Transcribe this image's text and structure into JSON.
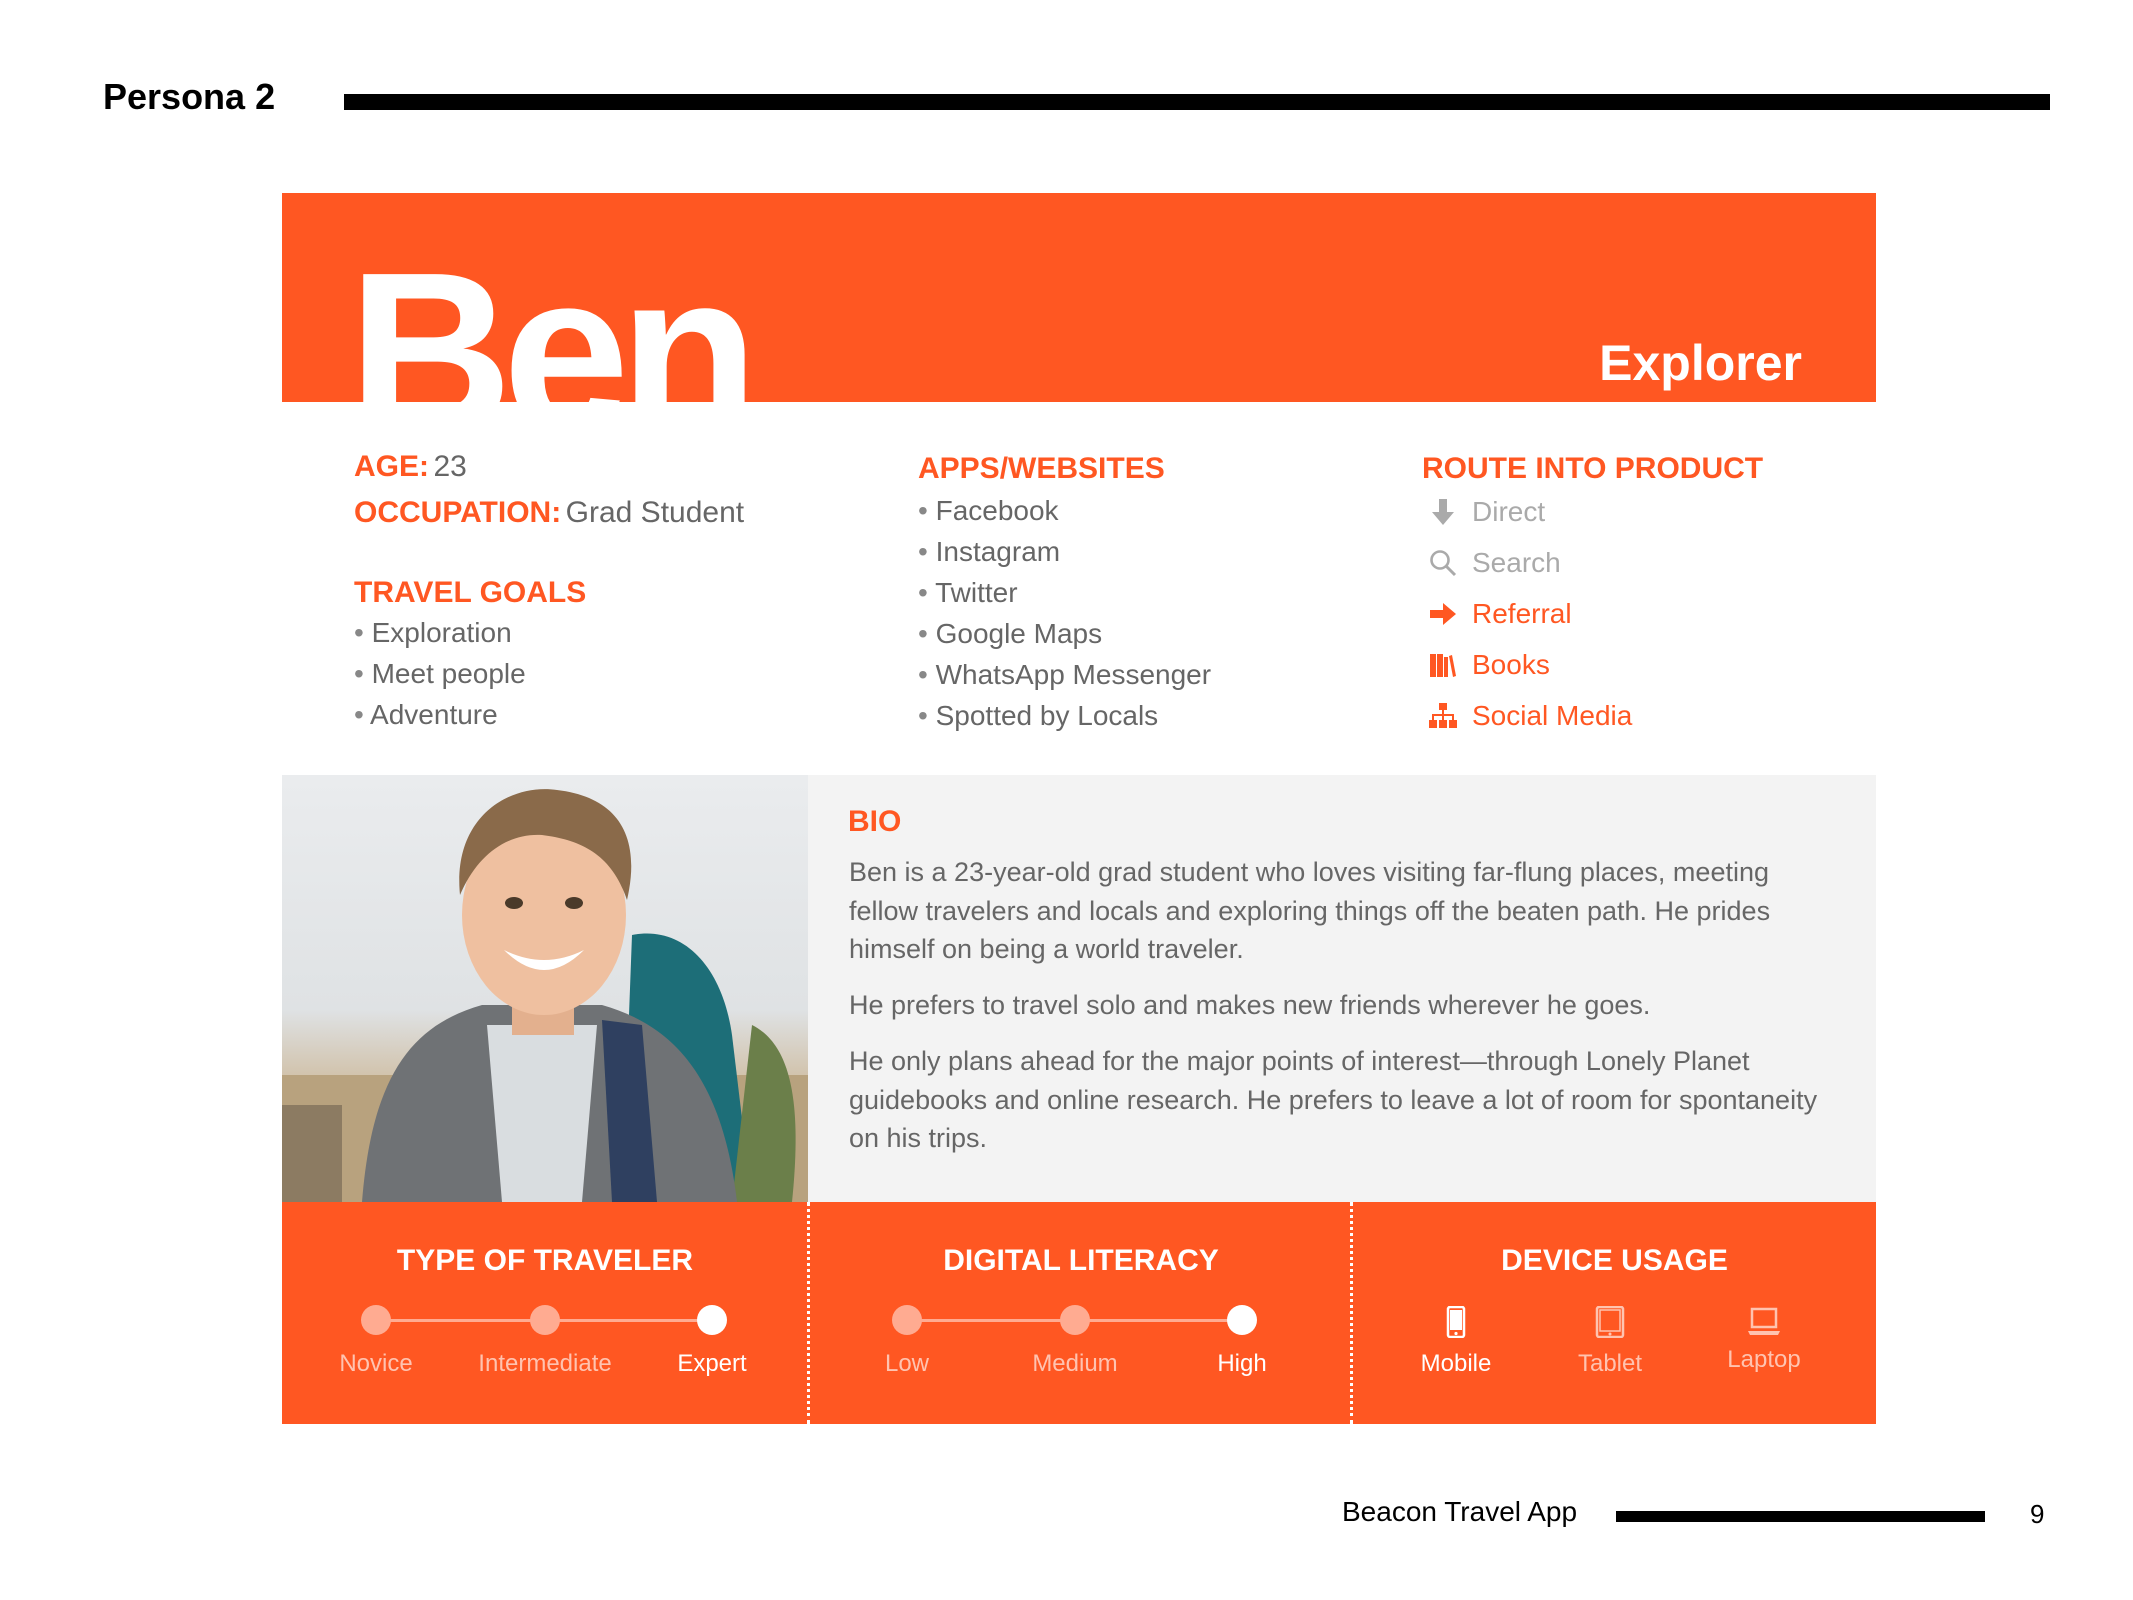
{
  "page": {
    "title": "Persona 2",
    "footer": "Beacon Travel App",
    "page_number": "9"
  },
  "persona": {
    "name": "Ben",
    "archetype": "Explorer"
  },
  "details": {
    "age_label": "AGE:",
    "age": "23",
    "occupation_label": "OCCUPATION:",
    "occupation": "Grad Student",
    "travel_goals_title": "TRAVEL GOALS",
    "travel_goals": [
      "Exploration",
      "Meet people",
      "Adventure"
    ]
  },
  "apps": {
    "title": "APPS/WEBSITES",
    "items": [
      "Facebook",
      "Instagram",
      "Twitter",
      "Google Maps",
      "WhatsApp Messenger",
      "Spotted by Locals"
    ]
  },
  "route": {
    "title": "ROUTE INTO PRODUCT",
    "items": [
      {
        "label": "Direct",
        "icon": "arrow-down-icon",
        "active": false
      },
      {
        "label": "Search",
        "icon": "search-icon",
        "active": false
      },
      {
        "label": "Referral",
        "icon": "arrow-right-icon",
        "active": true
      },
      {
        "label": "Books",
        "icon": "books-icon",
        "active": true
      },
      {
        "label": "Social Media",
        "icon": "sitemap-icon",
        "active": true
      }
    ]
  },
  "bio": {
    "title": "BIO",
    "paragraphs": [
      "Ben is a 23-year-old grad student who loves visiting far-flung places, meeting fellow travelers and locals and exploring things off the beaten path. He prides himself on being a world traveler.",
      "He prefers to travel solo and makes new friends wherever he goes.",
      "He only plans ahead for the major points of interest—through Lonely Planet guidebooks and online research. He prefers to leave a lot of room for spontaneity on his trips."
    ]
  },
  "traveler_type": {
    "title": "TYPE OF TRAVELER",
    "levels": [
      "Novice",
      "Intermediate",
      "Expert"
    ],
    "selected": "Expert"
  },
  "digital_literacy": {
    "title": "DIGITAL LITERACY",
    "levels": [
      "Low",
      "Medium",
      "High"
    ],
    "selected": "High"
  },
  "device_usage": {
    "title": "DEVICE USAGE",
    "devices": [
      {
        "label": "Mobile",
        "icon": "mobile-icon",
        "active": true
      },
      {
        "label": "Tablet",
        "icon": "tablet-icon",
        "active": false
      },
      {
        "label": "Laptop",
        "icon": "laptop-icon",
        "active": false
      }
    ]
  },
  "colors": {
    "accent": "#ff5722",
    "muted_text": "#666666",
    "light_bg": "#f3f3f3"
  }
}
